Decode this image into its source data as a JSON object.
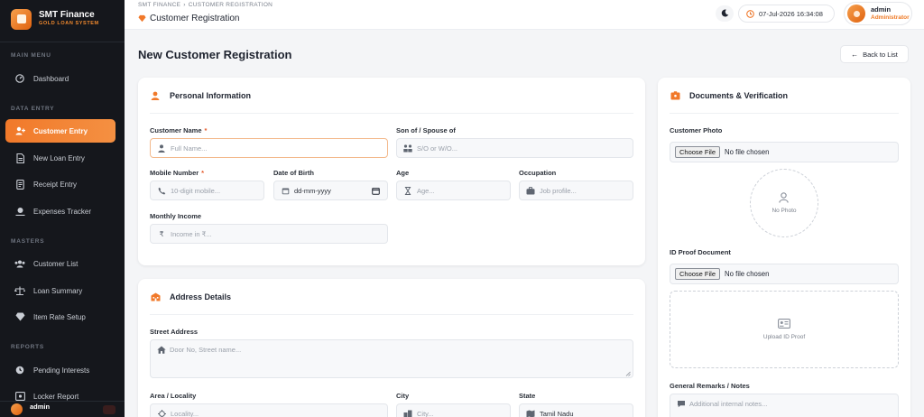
{
  "sidebar": {
    "brand_name": "SMT Finance",
    "brand_sub": "GOLD LOAN SYSTEM",
    "sections": [
      {
        "title": "MAIN MENU"
      },
      {
        "title": "DATA ENTRY"
      },
      {
        "title": "MASTERS"
      },
      {
        "title": "REPORTS"
      }
    ],
    "items": [
      {
        "label": "Dashboard",
        "icon": "dashboard-icon"
      },
      {
        "label": "Customer Entry",
        "icon": "add-user-icon",
        "active": true
      },
      {
        "label": "New Loan Entry",
        "icon": "document-icon"
      },
      {
        "label": "Receipt Entry",
        "icon": "receipt-icon"
      },
      {
        "label": "Expenses Tracker",
        "icon": "expenses-icon"
      },
      {
        "label": "Customer List",
        "icon": "users-icon"
      },
      {
        "label": "Loan Summary",
        "icon": "scale-icon"
      },
      {
        "label": "Item Rate Setup",
        "icon": "gem-icon"
      },
      {
        "label": "Pending Interests",
        "icon": "clock-icon"
      },
      {
        "label": "Locker Report",
        "icon": "locker-icon"
      }
    ],
    "footer_user": "admin"
  },
  "topbar": {
    "breadcrumb_root": "SMT FINANCE",
    "breadcrumb_current": "CUSTOMER REGISTRATION",
    "page_label": "Customer Registration",
    "datetime": "07-Jul-2026 16:34:08",
    "user_name": "admin",
    "user_role": "Administrator"
  },
  "main": {
    "title": "New Customer Registration",
    "back_label": "Back to List"
  },
  "personal": {
    "title": "Personal Information",
    "customer_name_label": "Customer Name",
    "customer_name_placeholder": "Full Name...",
    "relation_label": "Son of / Spouse of",
    "relation_placeholder": "S/O or W/O...",
    "mobile_label": "Mobile Number",
    "mobile_placeholder": "10-digit mobile...",
    "dob_label": "Date of Birth",
    "dob_value": "dd-mm-yyyy",
    "age_label": "Age",
    "age_placeholder": "Age...",
    "occupation_label": "Occupation",
    "occupation_placeholder": "Job profile...",
    "income_label": "Monthly Income",
    "income_placeholder": "Income in ₹...",
    "required_mark": "*"
  },
  "address": {
    "title": "Address Details",
    "street_label": "Street Address",
    "street_placeholder": "Door No, Street name...",
    "area_label": "Area / Locality",
    "area_placeholder": "Locality...",
    "city_label": "City",
    "city_placeholder": "City...",
    "state_label": "State",
    "state_value": "Tamil Nadu"
  },
  "documents": {
    "title": "Documents & Verification",
    "photo_label": "Customer Photo",
    "choose_file": "Choose File",
    "no_file": "No file chosen",
    "no_photo": "No Photo",
    "id_proof_label": "ID Proof Document",
    "upload_id_proof": "Upload ID Proof",
    "remarks_label": "General Remarks / Notes",
    "remarks_placeholder": "Additional internal notes..."
  },
  "colors": {
    "accent": "#f1792a",
    "sidebar_bg": "#15171c"
  }
}
